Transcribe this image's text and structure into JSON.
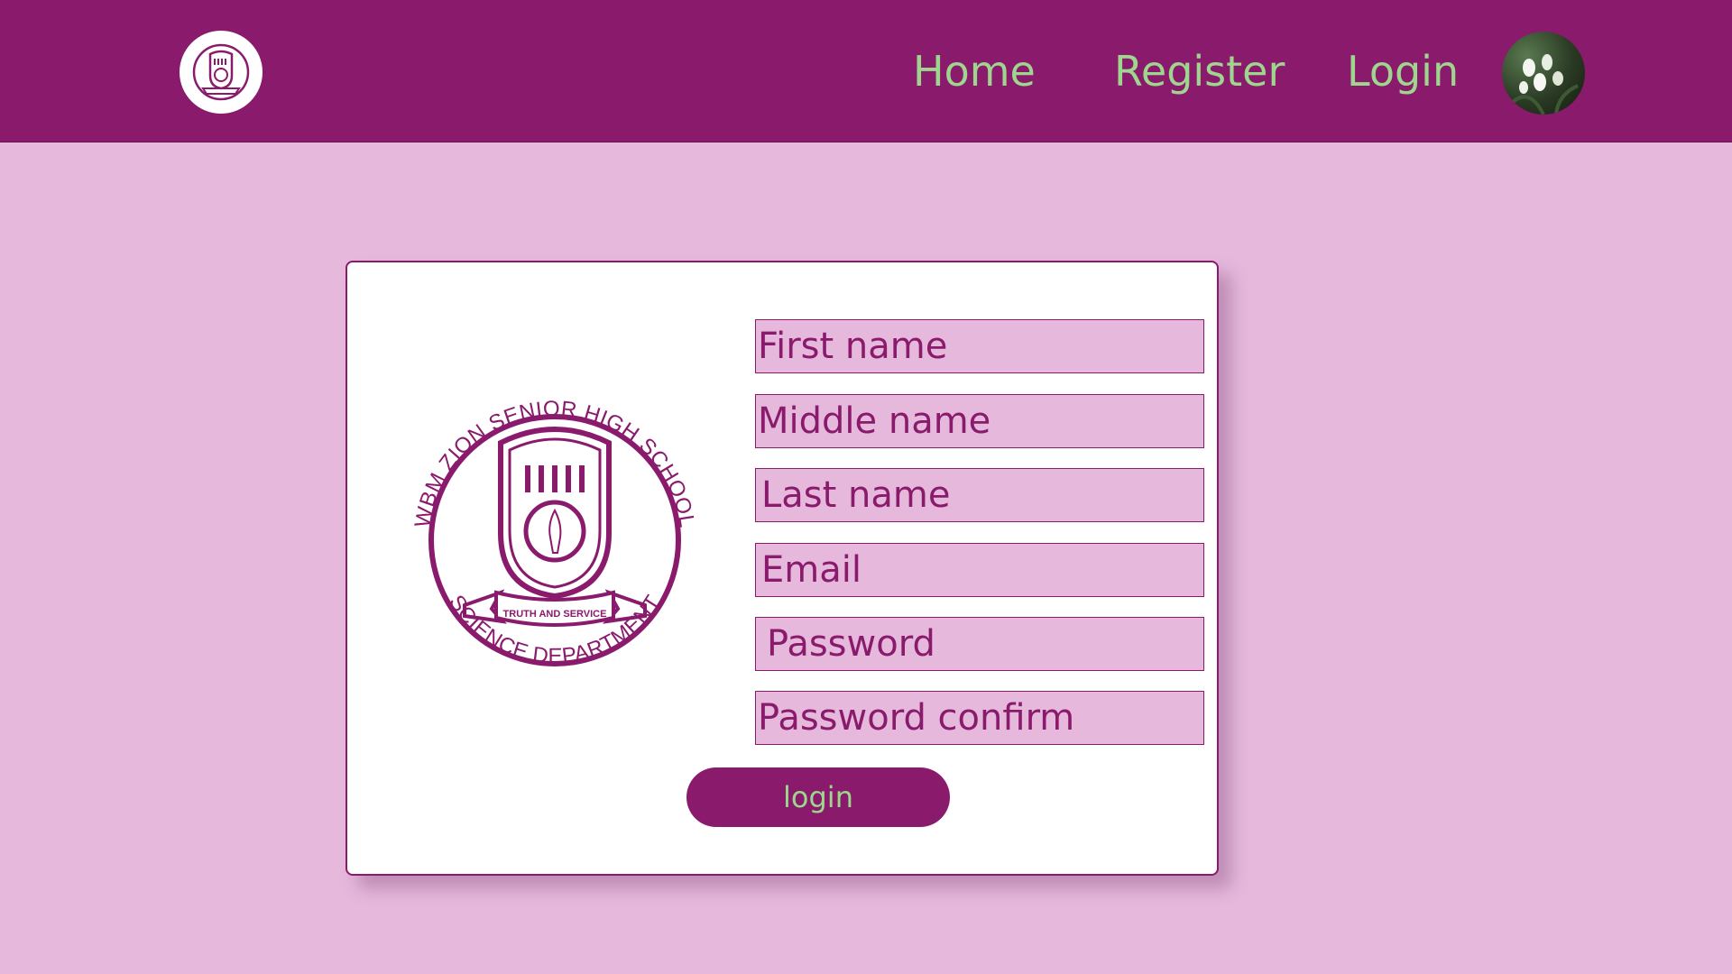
{
  "nav": {
    "links": [
      "Home",
      "Register",
      "Login"
    ]
  },
  "crest": {
    "top_text": "WBM ZION SENIOR HIGH SCHOOL",
    "bottom_text": "SCIENCE DEPARTMENT",
    "motto": "TRUTH AND SERVICE"
  },
  "form": {
    "first_name_placeholder": "First name",
    "middle_name_placeholder": "Middle name",
    "last_name_placeholder": "Last name",
    "email_placeholder": "Email",
    "password_placeholder": "Password",
    "password_confirm_placeholder": "Password confirm",
    "submit_label": "login"
  },
  "colors": {
    "brand": "#8a1a6c",
    "page_bg": "#e5b8dc",
    "accent_text": "#9ed68e"
  }
}
